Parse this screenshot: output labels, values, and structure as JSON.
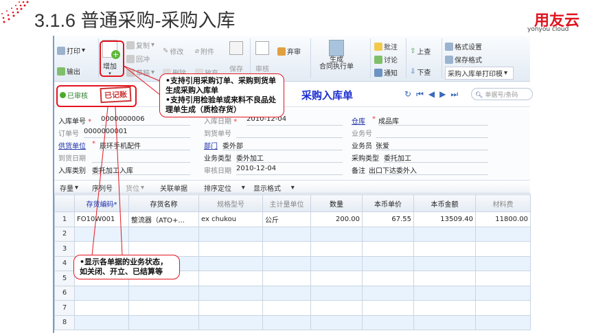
{
  "slide": {
    "title": "3.1.6 普通采购-采购入库",
    "logo_text": "用友云",
    "logo_sub": "yonyou cloud"
  },
  "toolbar": {
    "print": "打印",
    "export": "输出",
    "add": "增加",
    "copy": "复制",
    "reverse": "回冲",
    "draft": "草稿",
    "edit": "修改",
    "attach": "附件",
    "delete": "删除",
    "discard": "放弃",
    "save": "保存",
    "audit": "审核",
    "abandon_audit": "弃审",
    "gen_contract": "生成\n合同执行单",
    "annotate": "批注",
    "discuss": "讨论",
    "notify": "通知",
    "up_query": "上查",
    "down_query": "下查",
    "format_settings": "格式设置",
    "save_format": "保存格式",
    "print_template": "采购入库单打印模"
  },
  "status": {
    "audited": "已审核",
    "stamp": "已记账",
    "doc_title": "采购入库单",
    "search_placeholder": "单据号/条码"
  },
  "form": {
    "receipt_no_label": "入库单号",
    "receipt_no": "0000000006",
    "receipt_date_label": "入库日期",
    "receipt_date": "2010-12-04",
    "warehouse_label": "仓库",
    "warehouse": "成品库",
    "order_no_label": "订单号",
    "order_no": "0000000001",
    "arrival_no_label": "到货单号",
    "arrival_no": "",
    "biz_no_label": "业务号",
    "biz_no": "",
    "supplier_label": "供货单位",
    "supplier": "辰环手机配件",
    "dept_label": "部门",
    "dept": "委外部",
    "clerk_label": "业务员",
    "clerk": "张爱",
    "arrival_date_label": "到货日期",
    "arrival_date": "",
    "biz_type_label": "业务类型",
    "biz_type": "委外加工",
    "purchase_type_label": "采购类型",
    "purchase_type": "委托加工",
    "receipt_type_label": "入库类别",
    "receipt_type": "委托加工入库",
    "audit_date_label": "审核日期",
    "audit_date": "2010-12-04",
    "remark_label": "备注",
    "remark": "出口下达委外入"
  },
  "gridbar": {
    "stock": "存量",
    "serial": "序列号",
    "location": "货位",
    "related": "关联单据",
    "sort": "排序定位",
    "display": "显示格式"
  },
  "grid": {
    "headers": [
      "存货编码*",
      "存货名称",
      "规格型号",
      "主计量单位",
      "数量",
      "本币单价",
      "本币金额",
      "材料费"
    ],
    "rows": [
      {
        "no": "1",
        "code": "FO10W001",
        "name": "整流器（ATO+...",
        "spec": "ex chukou",
        "unit": "公斤",
        "qty": "200.00",
        "price": "67.55",
        "amount": "13509.40",
        "material": "11800.00"
      },
      {
        "no": "2"
      },
      {
        "no": "3"
      },
      {
        "no": "4"
      },
      {
        "no": "5"
      },
      {
        "no": "6"
      },
      {
        "no": "7"
      },
      {
        "no": "8"
      }
    ]
  },
  "callouts": {
    "c1_line1": "•支持引用采购订单、采购到货单生成采购入库单",
    "c1_line2": "•支持引用检验单或来料不良品处理单生成（质检存货）",
    "c2": "•显示各单据的业务状态，如关闭、开立、已结算等"
  }
}
